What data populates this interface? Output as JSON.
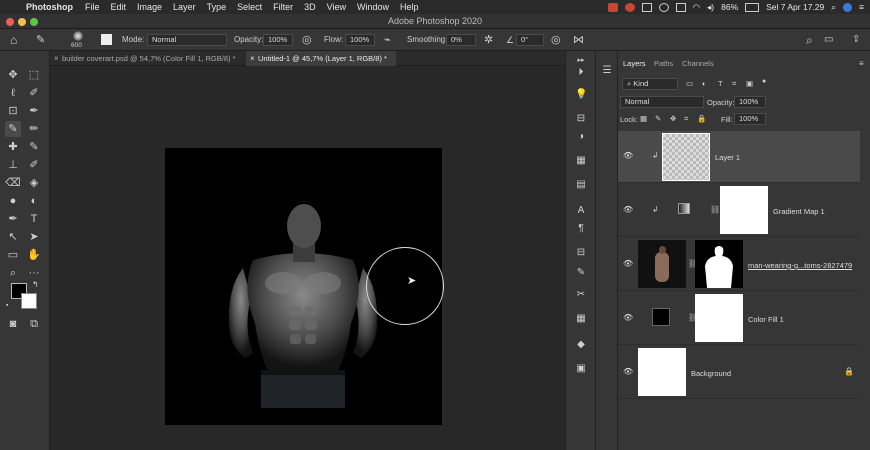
{
  "menubar": {
    "app_name": "Photoshop",
    "items": [
      "File",
      "Edit",
      "Image",
      "Layer",
      "Type",
      "Select",
      "Filter",
      "3D",
      "View",
      "Window",
      "Help"
    ],
    "battery": "86%",
    "clock": "Sel 7 Apr  17.29"
  },
  "window": {
    "title": "Adobe Photoshop 2020"
  },
  "options": {
    "brush_size": "600",
    "mode_label": "Mode:",
    "mode_value": "Normal",
    "opacity_label": "Opacity:",
    "opacity_value": "100%",
    "flow_label": "Flow:",
    "flow_value": "100%",
    "smoothing_label": "Smoothing:",
    "smoothing_value": "0%",
    "angle_value": "0°"
  },
  "tabs": [
    {
      "label": "builder coverart.psd @ 54,7% (Color Fill 1, RGB/8) *",
      "close": "×"
    },
    {
      "label": "Untitled-1 @ 45,7% (Layer 1, RGB/8) *",
      "close": "×"
    }
  ],
  "layers_panel": {
    "tabs": [
      "Layers",
      "Paths",
      "Channels"
    ],
    "kind_label": "Kind",
    "blend_mode": "Normal",
    "opacity_label": "Opacity:",
    "opacity_value": "100%",
    "lock_label": "Lock:",
    "fill_label": "Fill:",
    "fill_value": "100%",
    "layers": [
      {
        "name": "Layer 1"
      },
      {
        "name": "Gradient Map 1"
      },
      {
        "name": "man-wearing-g...toms-2827479"
      },
      {
        "name": "Color Fill 1"
      },
      {
        "name": "Background"
      }
    ]
  },
  "colors": {
    "accent_menu_red": "#cc4433",
    "panel_bg": "#363636",
    "canvas_bg": "#282828"
  },
  "icons": [
    "apple-icon",
    "home-icon",
    "brush-icon",
    "pressure-opacity-icon",
    "airbrush-icon",
    "pressure-size-icon",
    "symmetry-icon",
    "search-icon",
    "workspace-icon",
    "share-icon",
    "eye-icon",
    "link-icon",
    "lock-icon",
    "pointer-icon"
  ]
}
